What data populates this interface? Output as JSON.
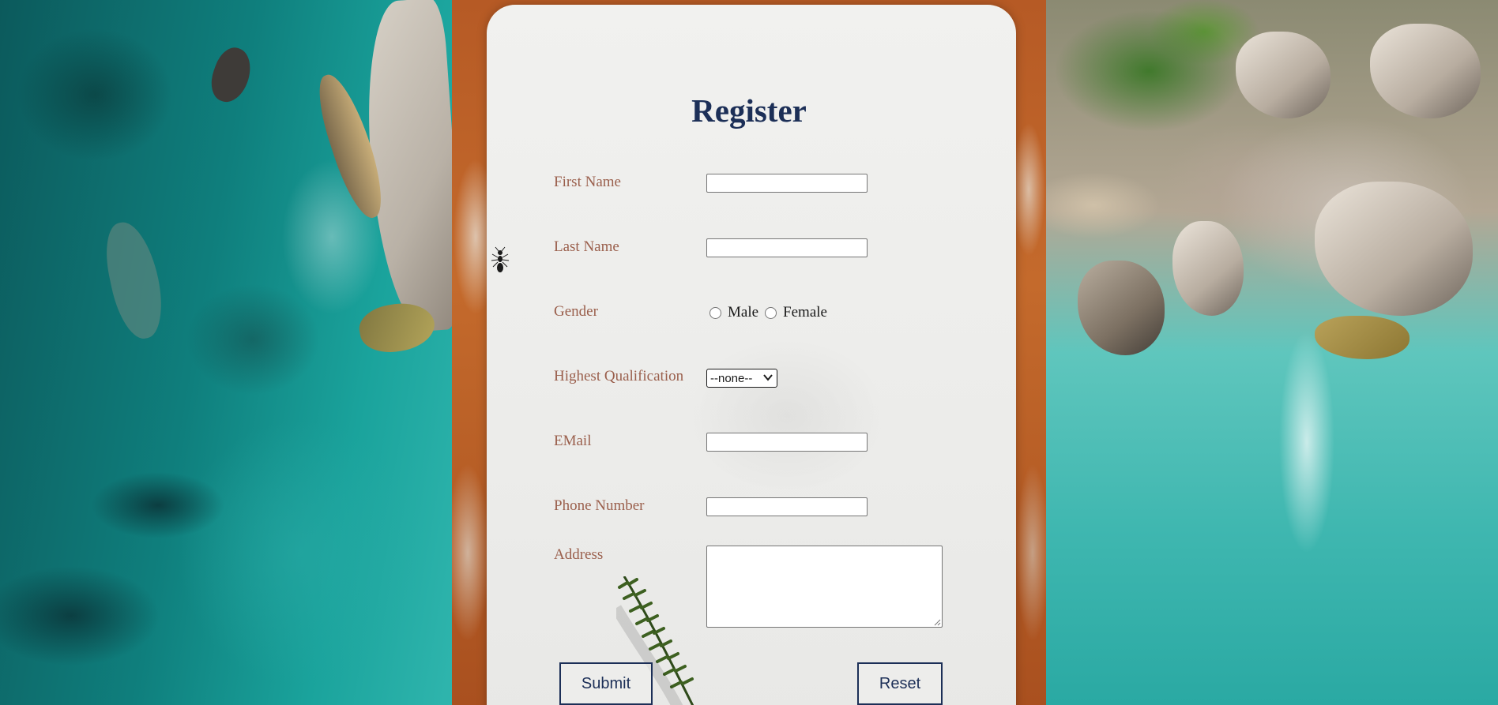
{
  "form": {
    "title": "Register",
    "fields": {
      "first_name": {
        "label": "First Name",
        "value": ""
      },
      "last_name": {
        "label": "Last Name",
        "value": ""
      },
      "gender": {
        "label": "Gender",
        "options": [
          "Male",
          "Female"
        ],
        "selected": null
      },
      "qualification": {
        "label": "Highest Qualification",
        "selected": "--none--"
      },
      "email": {
        "label": "EMail",
        "value": ""
      },
      "phone": {
        "label": "Phone Number",
        "value": ""
      },
      "address": {
        "label": "Address",
        "value": ""
      }
    },
    "buttons": {
      "submit_label": "Submit",
      "reset_label": "Reset"
    }
  },
  "colors": {
    "title": "#1c2f57",
    "label": "#9a5f4c",
    "button_border": "#1c2f57",
    "card": "#efefed"
  },
  "icons": {
    "select_chevron": "chevron-down-icon",
    "textarea_grip": "resize-grip-icon"
  }
}
